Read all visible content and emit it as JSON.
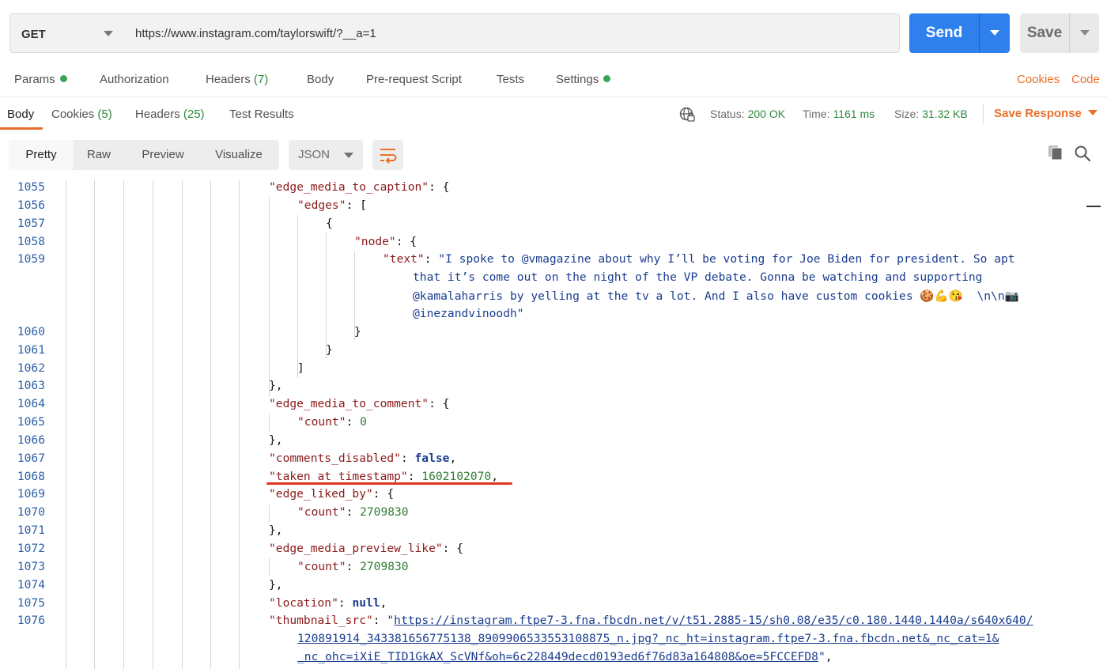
{
  "request": {
    "method": "GET",
    "url": "https://www.instagram.com/taylorswift/?__a=1",
    "send_label": "Send",
    "save_label": "Save"
  },
  "request_tabs": {
    "params": "Params",
    "authorization": "Authorization",
    "headers": "Headers",
    "headers_count": "(7)",
    "body": "Body",
    "pre_request": "Pre-request Script",
    "tests": "Tests",
    "settings": "Settings",
    "cookies": "Cookies",
    "code": "Code"
  },
  "response_tabs": {
    "body": "Body",
    "cookies": "Cookies",
    "cookies_count": "(5)",
    "headers": "Headers",
    "headers_count": "(25)",
    "test_results": "Test Results"
  },
  "response_status": {
    "status_label": "Status:",
    "status_value": "200 OK",
    "time_label": "Time:",
    "time_value": "1161 ms",
    "size_label": "Size:",
    "size_value": "31.32 KB",
    "save_response": "Save Response"
  },
  "format_bar": {
    "pretty": "Pretty",
    "raw": "Raw",
    "preview": "Preview",
    "visualize": "Visualize",
    "format": "JSON"
  },
  "code": {
    "gutter": [
      "1055",
      "1056",
      "1057",
      "1058",
      "1059",
      "",
      "",
      "",
      "1060",
      "1061",
      "1062",
      "1063",
      "1064",
      "1065",
      "1066",
      "1067",
      "1068",
      "1069",
      "1070",
      "1071",
      "1072",
      "1073",
      "1074",
      "1075",
      "1076",
      "",
      ""
    ],
    "lines": [
      {
        "indent": 340,
        "parts": [
          [
            "k",
            "\"edge_media_to_caption\""
          ],
          [
            "p",
            ": {"
          ]
        ]
      },
      {
        "indent": 376,
        "parts": [
          [
            "k",
            "\"edges\""
          ],
          [
            "p",
            ": ["
          ]
        ]
      },
      {
        "indent": 412,
        "parts": [
          [
            "p",
            "{"
          ]
        ]
      },
      {
        "indent": 448,
        "parts": [
          [
            "k",
            "\"node\""
          ],
          [
            "p",
            ": {"
          ]
        ]
      },
      {
        "indent": 484,
        "parts": [
          [
            "k",
            "\"text\""
          ],
          [
            "p",
            ": "
          ],
          [
            "s",
            "\"I spoke to @vmagazine about why I’ll be voting for Joe Biden for president. So apt"
          ]
        ]
      },
      {
        "indent": 522,
        "parts": [
          [
            "s",
            "that it’s come out on the night of the VP debate. Gonna be watching and supporting"
          ]
        ]
      },
      {
        "indent": 522,
        "parts": [
          [
            "s",
            "@kamalaharris by yelling at the tv a lot. And I also have custom cookies 🍪💪😘  \\n\\n📷"
          ]
        ]
      },
      {
        "indent": 522,
        "parts": [
          [
            "s",
            "@inezandvinoodh\""
          ]
        ]
      },
      {
        "indent": 448,
        "parts": [
          [
            "p",
            "}"
          ]
        ]
      },
      {
        "indent": 412,
        "parts": [
          [
            "p",
            "}"
          ]
        ]
      },
      {
        "indent": 376,
        "parts": [
          [
            "p",
            "]"
          ]
        ]
      },
      {
        "indent": 340,
        "parts": [
          [
            "p",
            "},"
          ]
        ]
      },
      {
        "indent": 340,
        "parts": [
          [
            "k",
            "\"edge_media_to_comment\""
          ],
          [
            "p",
            ": {"
          ]
        ]
      },
      {
        "indent": 376,
        "parts": [
          [
            "k",
            "\"count\""
          ],
          [
            "p",
            ": "
          ],
          [
            "n",
            "0"
          ]
        ]
      },
      {
        "indent": 340,
        "parts": [
          [
            "p",
            "},"
          ]
        ]
      },
      {
        "indent": 340,
        "parts": [
          [
            "k",
            "\"comments_disabled\""
          ],
          [
            "p",
            ": "
          ],
          [
            "b",
            "false"
          ],
          [
            "p",
            ","
          ]
        ]
      },
      {
        "indent": 340,
        "parts": [
          [
            "k",
            "\"taken_at_timestamp\""
          ],
          [
            "p",
            ": "
          ],
          [
            "n",
            "1602102070"
          ],
          [
            "p",
            ","
          ]
        ]
      },
      {
        "indent": 340,
        "parts": [
          [
            "k",
            "\"edge_liked_by\""
          ],
          [
            "p",
            ": {"
          ]
        ]
      },
      {
        "indent": 376,
        "parts": [
          [
            "k",
            "\"count\""
          ],
          [
            "p",
            ": "
          ],
          [
            "n",
            "2709830"
          ]
        ]
      },
      {
        "indent": 340,
        "parts": [
          [
            "p",
            "},"
          ]
        ]
      },
      {
        "indent": 340,
        "parts": [
          [
            "k",
            "\"edge_media_preview_like\""
          ],
          [
            "p",
            ": {"
          ]
        ]
      },
      {
        "indent": 376,
        "parts": [
          [
            "k",
            "\"count\""
          ],
          [
            "p",
            ": "
          ],
          [
            "n",
            "2709830"
          ]
        ]
      },
      {
        "indent": 340,
        "parts": [
          [
            "p",
            "},"
          ]
        ]
      },
      {
        "indent": 340,
        "parts": [
          [
            "k",
            "\"location\""
          ],
          [
            "p",
            ": "
          ],
          [
            "b",
            "null"
          ],
          [
            "p",
            ","
          ]
        ]
      },
      {
        "indent": 340,
        "parts": [
          [
            "k",
            "\"thumbnail_src\""
          ],
          [
            "p",
            ": "
          ],
          [
            "s",
            "\""
          ],
          [
            "lnk",
            "https://instagram.ftpe7-3.fna.fbcdn.net/v/t51.2885-15/sh0.08/e35/c0.180.1440.1440a/s640x640/"
          ]
        ]
      },
      {
        "indent": 376,
        "parts": [
          [
            "lnk",
            "120891914_343381656775138_8909906533553108875_n.jpg?_nc_ht=instagram.ftpe7-3.fna.fbcdn.net&_nc_cat=1&"
          ]
        ]
      },
      {
        "indent": 376,
        "parts": [
          [
            "lnk",
            "_nc_ohc=iXiE_TID1GkAX_ScVNf&oh=6c228449decd0193ed6f76d83a164808&oe=5FCCEFD8"
          ],
          [
            "s",
            "\""
          ],
          [
            "p",
            ","
          ]
        ]
      }
    ]
  }
}
